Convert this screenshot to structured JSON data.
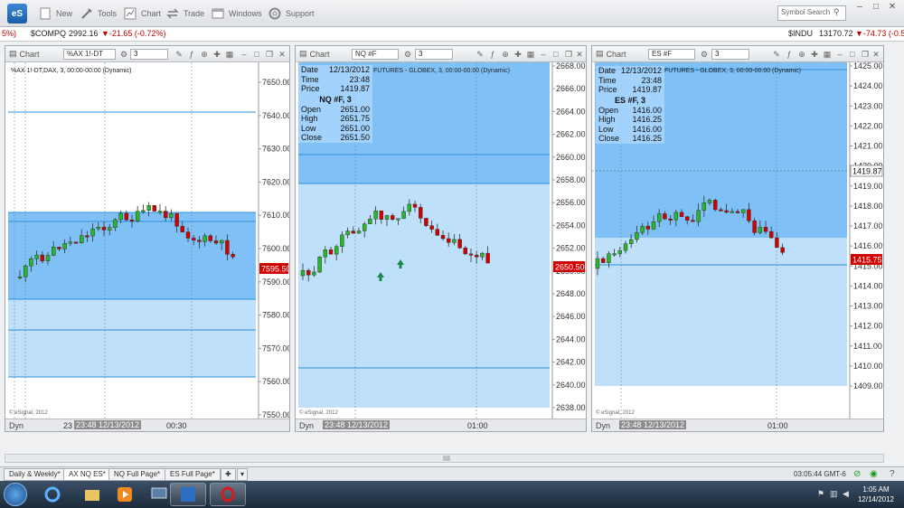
{
  "toolbar": {
    "logo": "eS",
    "new": "New",
    "tools": "Tools",
    "chart": "Chart",
    "trade": "Trade",
    "windows": "Windows",
    "support": "Support",
    "search_placeholder": "Symbol Search"
  },
  "ticker": {
    "lead": "5%)",
    "comp_sym": "$COMPQ",
    "comp_last": "2992.16",
    "comp_chg": "▼-21.65 (-0.72%)",
    "indu_sym": "$INDU",
    "indu_last": "13170.72",
    "indu_chg": "▼-74.73 (-0.5"
  },
  "panes": [
    {
      "title": "Chart",
      "symbol": "%AX 1!-DT",
      "interval": "3",
      "subtitle": "%AX 1!-DT,DAX, 3, 00:00-00:00 (Dynamic)",
      "copyright": "© eSignal, 2012",
      "dyn": "Dyn",
      "cursor_date": "23:48 12/13/2012",
      "date_left": "23",
      "time_label": "00:30",
      "price_tag": "7595.50",
      "yaxis": [
        "7650.00",
        "7640.00",
        "7630.00",
        "7620.00",
        "7610.00",
        "7600.00",
        "7590.00",
        "7580.00",
        "7570.00",
        "7560.00",
        "7550.00"
      ]
    },
    {
      "title": "Chart",
      "symbol": "NQ #F",
      "interval": "3",
      "subtitle": "FUTURES - GLOBEX, 3, 00:00-00:00 (Dynamic)",
      "copyright": "© eSignal, 2012",
      "dyn": "Dyn",
      "cursor_date": "23:48 12/13/2012",
      "time_label": "01:00",
      "price_tag": "2650.50",
      "yaxis": [
        "2668.00",
        "2666.00",
        "2664.00",
        "2662.00",
        "2660.00",
        "2658.00",
        "2656.00",
        "2654.00",
        "2652.00",
        "2650.00",
        "2648.00",
        "2646.00",
        "2644.00",
        "2642.00",
        "2640.00",
        "2638.00"
      ],
      "data_window": {
        "date_label": "Date",
        "date": "12/13/2012",
        "time_label": "Time",
        "time": "23:48",
        "price_label": "Price",
        "price": "1419.87",
        "sym": "NQ #F, 3",
        "open_label": "Open",
        "open": "2651.00",
        "high_label": "High",
        "high": "2651.75",
        "low_label": "Low",
        "low": "2651.00",
        "close_label": "Close",
        "close": "2651.50"
      }
    },
    {
      "title": "Chart",
      "symbol": "ES #F",
      "interval": "3",
      "subtitle": "FUTURES - GLOBEX, 3, 00:00-00:00 (Dynamic)",
      "copyright": "© eSignal, 2012",
      "dyn": "Dyn",
      "cursor_date": "23:48 12/13/2012",
      "time_label": "01:00",
      "price_tag": "1415.75",
      "crosshair_tag": "1419.87",
      "yaxis": [
        "1425.00",
        "1424.00",
        "1423.00",
        "1422.00",
        "1421.00",
        "1420.00",
        "1419.00",
        "1418.00",
        "1417.00",
        "1416.00",
        "1415.00",
        "1414.00",
        "1413.00",
        "1412.00",
        "1411.00",
        "1410.00",
        "1409.00"
      ],
      "data_window": {
        "date_label": "Date",
        "date": "12/13/2012",
        "time_label": "Time",
        "time": "23:48",
        "price_label": "Price",
        "price": "1419.87",
        "sym": "ES #F, 3",
        "open_label": "Open",
        "open": "1416.00",
        "high_label": "High",
        "high": "1416.25",
        "low_label": "Low",
        "low": "1416.00",
        "close_label": "Close",
        "close": "1416.25"
      }
    }
  ],
  "tabs": [
    "Daily & Weekly*",
    "AX NQ ES*",
    "NQ Full Page*",
    "ES Full Page*"
  ],
  "status_time": "03:05:44 GMT-6",
  "clock": {
    "time": "1:05 AM",
    "date": "12/14/2012"
  },
  "colors": {
    "up": "#2ab52a",
    "down": "#d40000",
    "band": "#7fc1f7",
    "band_light": "#bfe0fb",
    "tag": "#d40000"
  }
}
